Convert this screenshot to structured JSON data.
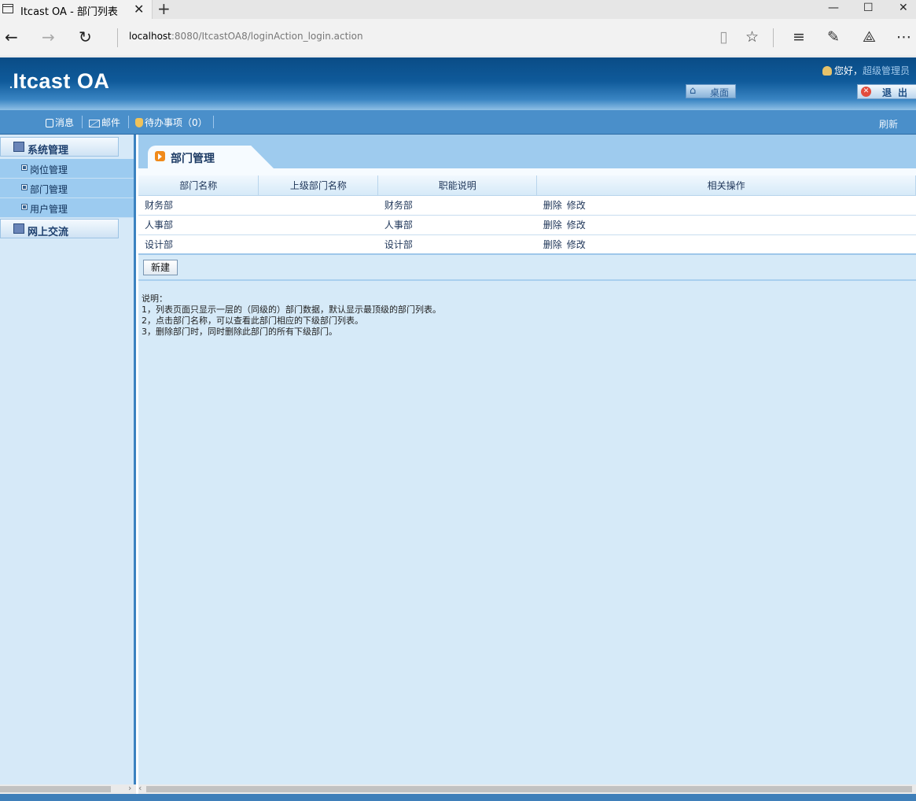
{
  "browser": {
    "tab_title": "Itcast OA - 部门列表",
    "url_host": "localhost",
    "url_path": ":8080/ItcastOA8/loginAction_login.action"
  },
  "header": {
    "logo_dot": ".",
    "logo": "Itcast OA",
    "greeting": "您好，",
    "username": "超级管理员",
    "desktop_label": "桌面",
    "logout_label": "退出"
  },
  "topnav": {
    "items": [
      "消息",
      "邮件",
      "待办事项（0）"
    ],
    "refresh": "刷新"
  },
  "sidebar": {
    "groups": [
      {
        "label": "系统管理",
        "items": [
          "岗位管理",
          "部门管理",
          "用户管理"
        ]
      },
      {
        "label": "网上交流",
        "items": []
      }
    ]
  },
  "main": {
    "title": "部门管理",
    "columns": [
      "部门名称",
      "上级部门名称",
      "职能说明",
      "相关操作"
    ],
    "rows": [
      {
        "name": "财务部",
        "parent": "",
        "desc": "财务部",
        "ops": [
          "删除",
          "修改"
        ]
      },
      {
        "name": "人事部",
        "parent": "",
        "desc": "人事部",
        "ops": [
          "删除",
          "修改"
        ]
      },
      {
        "name": "设计部",
        "parent": "",
        "desc": "设计部",
        "ops": [
          "删除",
          "修改"
        ]
      }
    ],
    "new_button": "新建",
    "notes": [
      "说明：",
      "1，列表页面只显示一层的（同级的）部门数据，默认显示最顶级的部门列表。",
      "2，点击部门名称，可以查看此部门相应的下级部门列表。",
      "3，删除部门时，同时删除此部门的所有下级部门。"
    ]
  }
}
